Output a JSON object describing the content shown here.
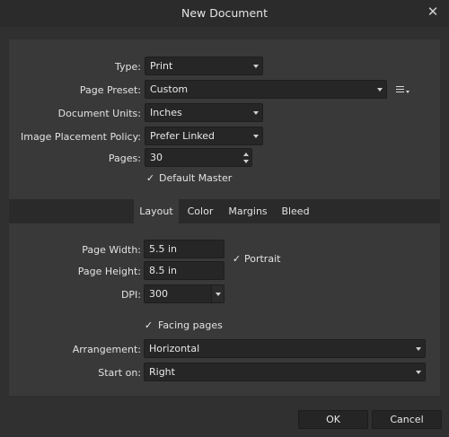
{
  "window": {
    "title": "New Document",
    "close_glyph": "✕"
  },
  "form": {
    "type_label": "Type:",
    "type_value": "Print",
    "preset_label": "Page Preset:",
    "preset_value": "Custom",
    "units_label": "Document Units:",
    "units_value": "Inches",
    "placement_label": "Image Placement Policy:",
    "placement_value": "Prefer Linked",
    "pages_label": "Pages:",
    "pages_value": "30",
    "default_master_label": "Default Master",
    "default_master_checked": true
  },
  "tabs": [
    {
      "label": "Layout",
      "active": true
    },
    {
      "label": "Color",
      "active": false
    },
    {
      "label": "Margins",
      "active": false
    },
    {
      "label": "Bleed",
      "active": false
    }
  ],
  "layout": {
    "page_width_label": "Page Width:",
    "page_width_value": "5.5 in",
    "page_height_label": "Page Height:",
    "page_height_value": "8.5 in",
    "portrait_label": "Portrait",
    "portrait_checked": true,
    "dpi_label": "DPI:",
    "dpi_value": "300",
    "facing_label": "Facing pages",
    "facing_checked": true,
    "arrangement_label": "Arrangement:",
    "arrangement_value": "Horizontal",
    "start_label": "Start on:",
    "start_value": "Right"
  },
  "footer": {
    "ok_label": "OK",
    "cancel_label": "Cancel"
  },
  "check_glyph": "✓",
  "colors": {
    "background": "#303030",
    "panel": "#393939",
    "field": "#262626"
  }
}
